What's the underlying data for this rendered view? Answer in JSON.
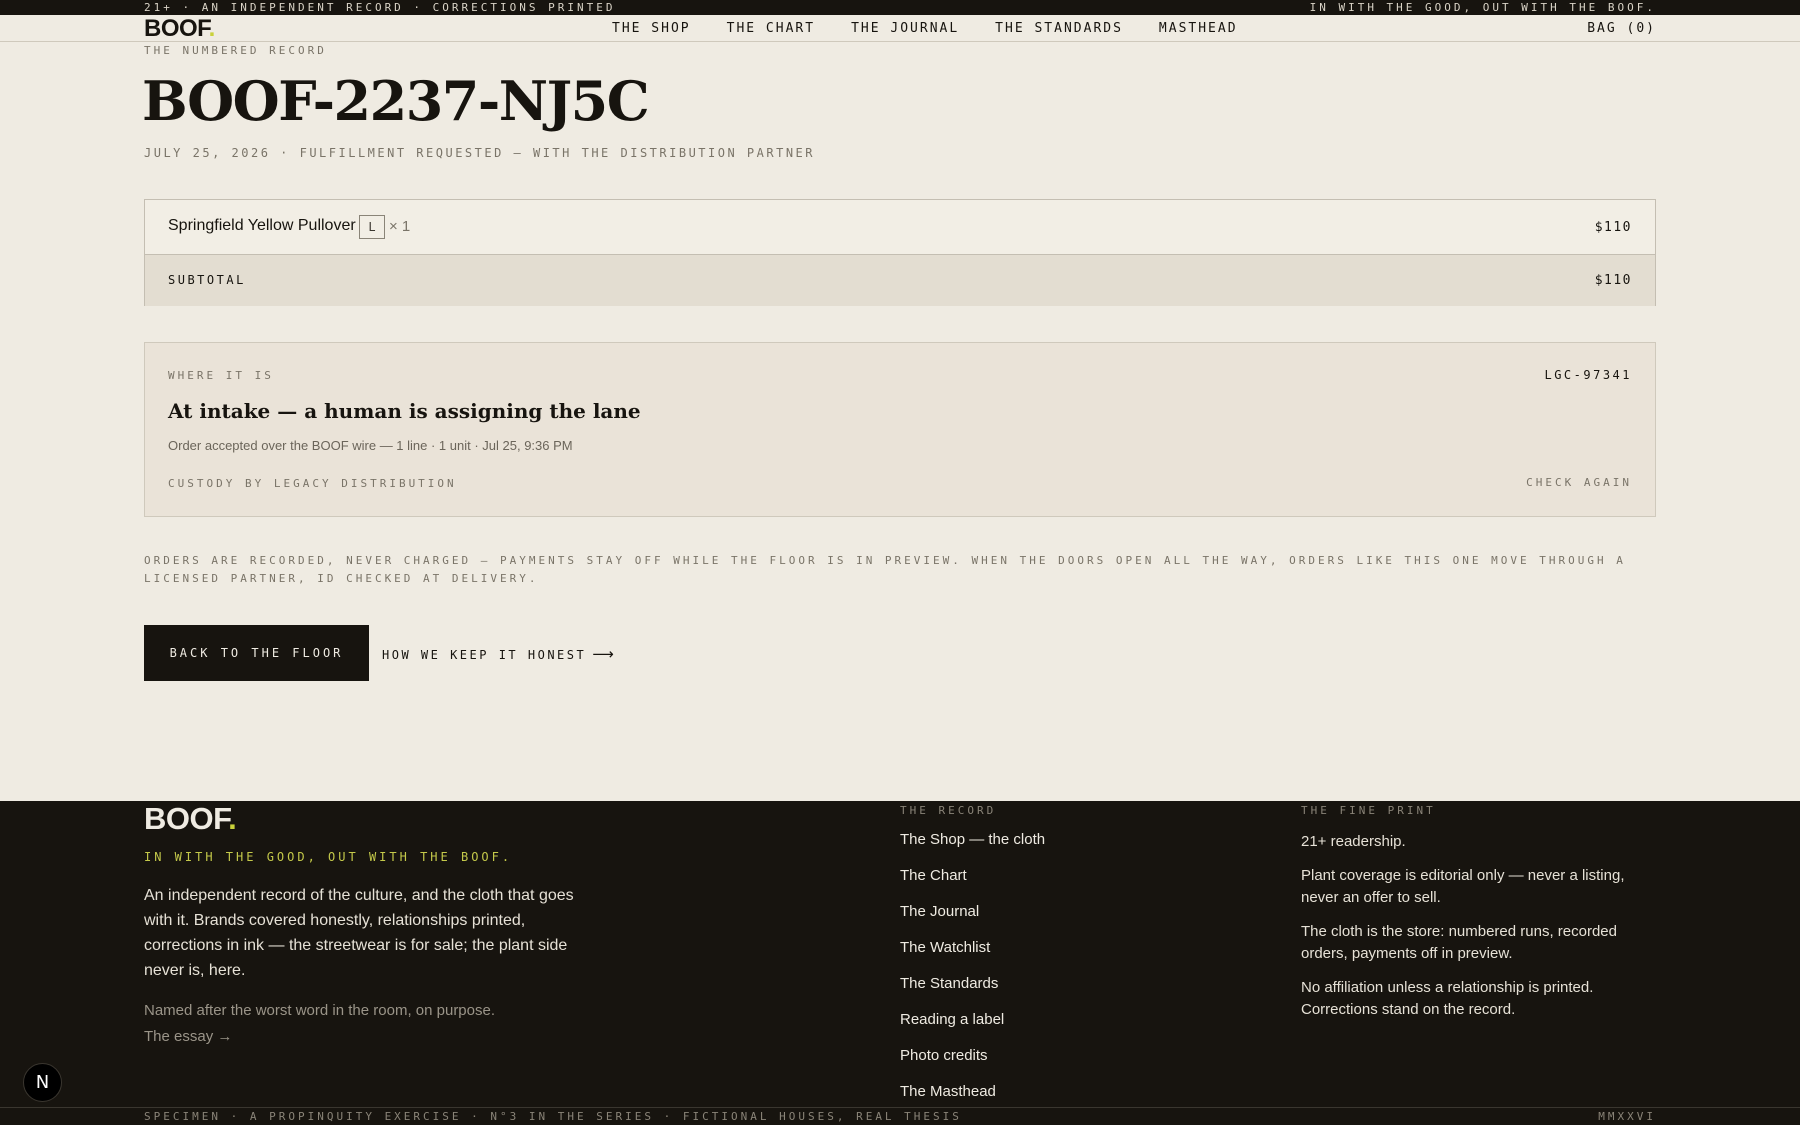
{
  "utility": {
    "left": "21+ · AN INDEPENDENT RECORD · CORRECTIONS PRINTED",
    "right": "IN WITH THE GOOD, OUT WITH THE BOOF."
  },
  "header": {
    "logo": "BOOF",
    "logo_dot": ".",
    "nav": [
      "THE SHOP",
      "THE CHART",
      "THE JOURNAL",
      "THE STANDARDS",
      "MASTHEAD"
    ],
    "bag": "BAG (0)"
  },
  "order": {
    "eyebrow": "THE NUMBERED RECORD",
    "number": "BOOF-2237-NJ5C",
    "meta": "JULY 25, 2026 · FULFILLMENT REQUESTED — WITH THE DISTRIBUTION PARTNER"
  },
  "items": [
    {
      "name": "Springfield Yellow Pullover",
      "size": "L",
      "qty": "× 1",
      "price": "$110"
    }
  ],
  "subtotal": {
    "label": "SUBTOTAL",
    "value": "$110"
  },
  "tracking": {
    "eyebrow": "WHERE IT IS",
    "id": "LGC-97341",
    "status": "At intake — a human is assigning the lane",
    "detail": "Order accepted over the BOOF wire — 1 line · 1 unit · Jul 25, 9:36 PM",
    "custody": "CUSTODY BY LEGACY DISTRIBUTION",
    "check": "CHECK AGAIN"
  },
  "notice": "ORDERS ARE RECORDED, NEVER CHARGED — PAYMENTS STAY OFF WHILE THE FLOOR IS IN PREVIEW. WHEN THE DOORS OPEN ALL THE WAY, ORDERS LIKE THIS ONE MOVE THROUGH A LICENSED PARTNER, ID CHECKED AT DELIVERY.",
  "actions": {
    "primary": "BACK TO THE FLOOR",
    "secondary": "HOW WE KEEP IT HONEST",
    "secondary_arrow": "⟶"
  },
  "footer": {
    "logo": "BOOF",
    "logo_dot": ".",
    "tagline": "IN WITH THE GOOD, OUT WITH THE BOOF.",
    "about": "An independent record of the culture, and the cloth that goes with it. Brands covered honestly, relationships printed, corrections in ink — the streetwear is for sale; the plant side never is, here.",
    "named": "Named after the worst word in the room, on purpose.",
    "essay": "The essay →",
    "record_heading": "THE RECORD",
    "record_links": [
      "The Shop — the cloth",
      "The Chart",
      "The Journal",
      "The Watchlist",
      "The Standards",
      "Reading a label",
      "Photo credits",
      "The Masthead"
    ],
    "fine_heading": "THE FINE PRINT",
    "fine_print": [
      "21+ readership.",
      "Plant coverage is editorial only — never a listing, never an offer to sell.",
      "The cloth is the store: numbered runs, recorded orders, payments off in preview.",
      "No affiliation unless a relationship is printed. Corrections stand on the record."
    ]
  },
  "bottom": {
    "left": "SPECIMEN · A PROPINQUITY EXERCISE · N°3 IN THE SERIES · FICTIONAL HOUSES, REAL THESIS",
    "right": "MMXXVI"
  },
  "dev_badge": "N",
  "colors": {
    "paper": "#efebe2",
    "ink": "#17140f",
    "accent": "#c9d13a",
    "muted": "#7a7468"
  }
}
